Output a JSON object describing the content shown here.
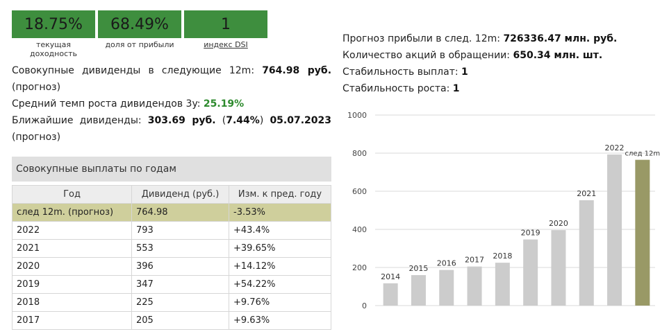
{
  "kpis": [
    {
      "value": "18.75%",
      "label": "текущая доходность"
    },
    {
      "value": "68.49%",
      "label": "доля от прибыли"
    },
    {
      "value": "1",
      "label": "индекс DSI"
    }
  ],
  "summary": {
    "total_div_prefix": "Совокупные дивиденды в следующие 12m:",
    "total_div_value": "764.98 руб.",
    "total_div_suffix": "(прогноз)",
    "growth_prefix": "Средний темп роста дивидендов 3y:",
    "growth_value": "25.19%",
    "nearest_prefix": "Ближайшие дивиденды:",
    "nearest_value": "303.69 руб.",
    "nearest_pct": "7.44%",
    "nearest_date": "05.07.2023",
    "nearest_suffix": "(прогноз)"
  },
  "stats": {
    "profit_label": "Прогноз прибыли в след. 12m:",
    "profit_value": "726336.47 млн. руб.",
    "shares_label": "Количество акций в обращении:",
    "shares_value": "650.34 млн. шт.",
    "stability_label": "Стабильность выплат:",
    "stability_value": "1",
    "growth_stability_label": "Стабильность роста:",
    "growth_stability_value": "1"
  },
  "table": {
    "title": "Совокупные выплаты по годам",
    "headers": [
      "Год",
      "Дивиденд (руб.)",
      "Изм. к пред. году"
    ],
    "rows": [
      {
        "year": "след 12m. (прогноз)",
        "div": "764.98",
        "change": "-3.53%"
      },
      {
        "year": "2022",
        "div": "793",
        "change": "+43.4%"
      },
      {
        "year": "2021",
        "div": "553",
        "change": "+39.65%"
      },
      {
        "year": "2020",
        "div": "396",
        "change": "+14.12%"
      },
      {
        "year": "2019",
        "div": "347",
        "change": "+54.22%"
      },
      {
        "year": "2018",
        "div": "225",
        "change": "+9.76%"
      },
      {
        "year": "2017",
        "div": "205",
        "change": "+9.63%"
      }
    ]
  },
  "colors": {
    "kpi_bg": "#3e8e3e",
    "bar": "#cccccc",
    "bar_forecast": "#999966",
    "forecast_row": "#cfcf9c",
    "positive": "#2d8a2d",
    "negative": "#e03030"
  },
  "chart_data": {
    "type": "bar",
    "categories": [
      "2014",
      "2015",
      "2016",
      "2017",
      "2018",
      "2019",
      "2020",
      "2021",
      "2022",
      "след 12m"
    ],
    "values": [
      117,
      160,
      187,
      205,
      225,
      347,
      396,
      553,
      793,
      764.98
    ],
    "ylim": [
      0,
      1000
    ],
    "yticks": [
      "0",
      "200",
      "400",
      "600",
      "800",
      "1000"
    ],
    "grid": true,
    "legend": "none"
  }
}
